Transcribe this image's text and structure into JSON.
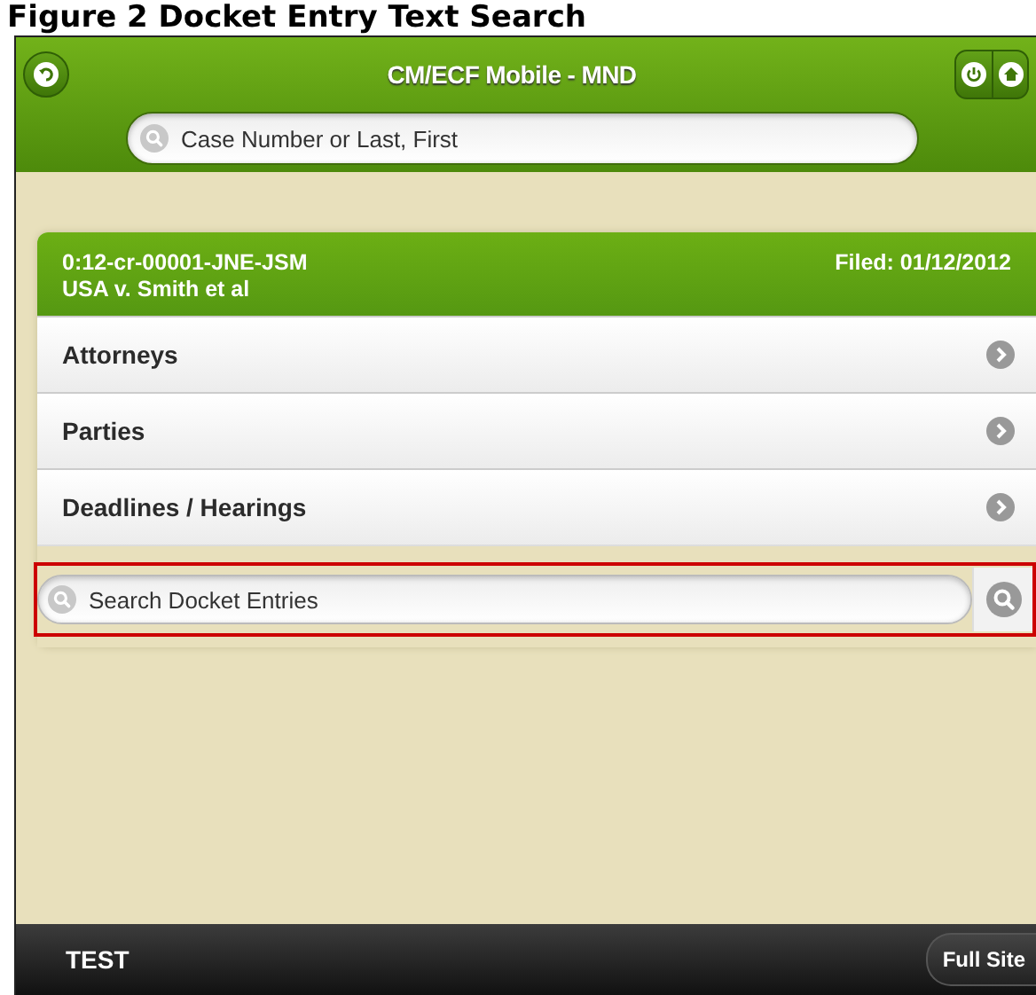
{
  "figure_caption": "Figure 2 Docket Entry Text Search",
  "header": {
    "title": "CM/ECF Mobile - MND",
    "search": {
      "placeholder": "Case Number or Last, First"
    }
  },
  "case": {
    "number": "0:12-cr-00001-JNE-JSM",
    "filed": "Filed: 01/12/2012",
    "title": "USA v. Smith et al"
  },
  "menu": [
    {
      "label": "Attorneys"
    },
    {
      "label": "Parties"
    },
    {
      "label": "Deadlines / Hearings"
    }
  ],
  "docket_search": {
    "placeholder": "Search Docket Entries",
    "highlighted": true
  },
  "footer": {
    "label": "TEST",
    "button": "Full Site"
  }
}
